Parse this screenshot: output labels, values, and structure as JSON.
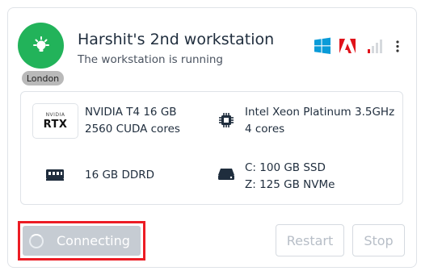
{
  "workstation": {
    "name": "Harshit's 2nd workstation",
    "status_text": "The workstation is running",
    "location": "London",
    "status_color": "#22b35a"
  },
  "header_icons": [
    "windows-icon",
    "adobe-icon",
    "signal-icon",
    "more-options-icon"
  ],
  "specs": {
    "gpu": {
      "badge_small": "NVIDIA",
      "badge_big": "RTX",
      "line1": "NVIDIA T4 16 GB",
      "line2": "2560 CUDA cores"
    },
    "cpu": {
      "line1": "Intel Xeon Platinum 3.5GHz",
      "line2": "4 cores"
    },
    "ram": {
      "line1": "16 GB DDRD"
    },
    "storage": {
      "line1": "C: 100 GB SSD",
      "line2": "Z: 125 GB NVMe"
    }
  },
  "actions": {
    "connect_label": "Connecting",
    "restart_label": "Restart",
    "stop_label": "Stop"
  },
  "colors": {
    "accent_windows": "#0a9bd8",
    "adobe_red": "#e0131b",
    "highlight_red": "#ec1c24"
  }
}
